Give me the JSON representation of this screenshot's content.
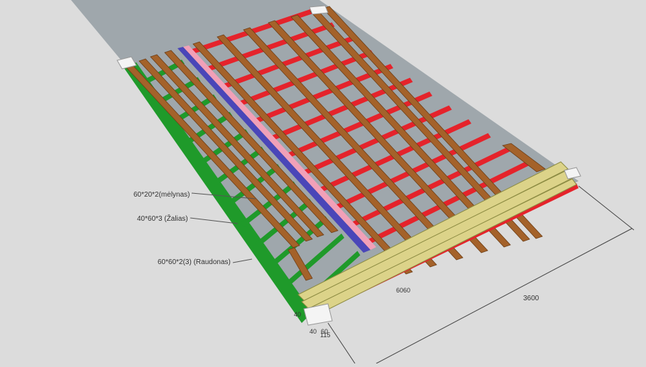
{
  "scene": {
    "background": "#dcdcdc",
    "ground": "#9fa7ac"
  },
  "colors": {
    "wood": "#a4622a",
    "wood_edge": "#6e3f17",
    "red_profile": "#e5232b",
    "green_profile": "#1f9a2a",
    "blue_profile": "#4a46b8",
    "pink_profile": "#f1a0b8",
    "board": "#dcd389",
    "board_edge": "#8c8b42",
    "dimension_line": "#444444",
    "label_text": "#333333"
  },
  "labels": {
    "blue": "60*20*2(mėlynas)",
    "green": "40*60*3 (Žalias)",
    "red": "60*60*2(3) (Raudonas)"
  },
  "dimensions": {
    "length": "3600",
    "d1": "40",
    "d2": "60",
    "d3": "115",
    "d4": "40",
    "d5": "60",
    "d6": "60"
  }
}
